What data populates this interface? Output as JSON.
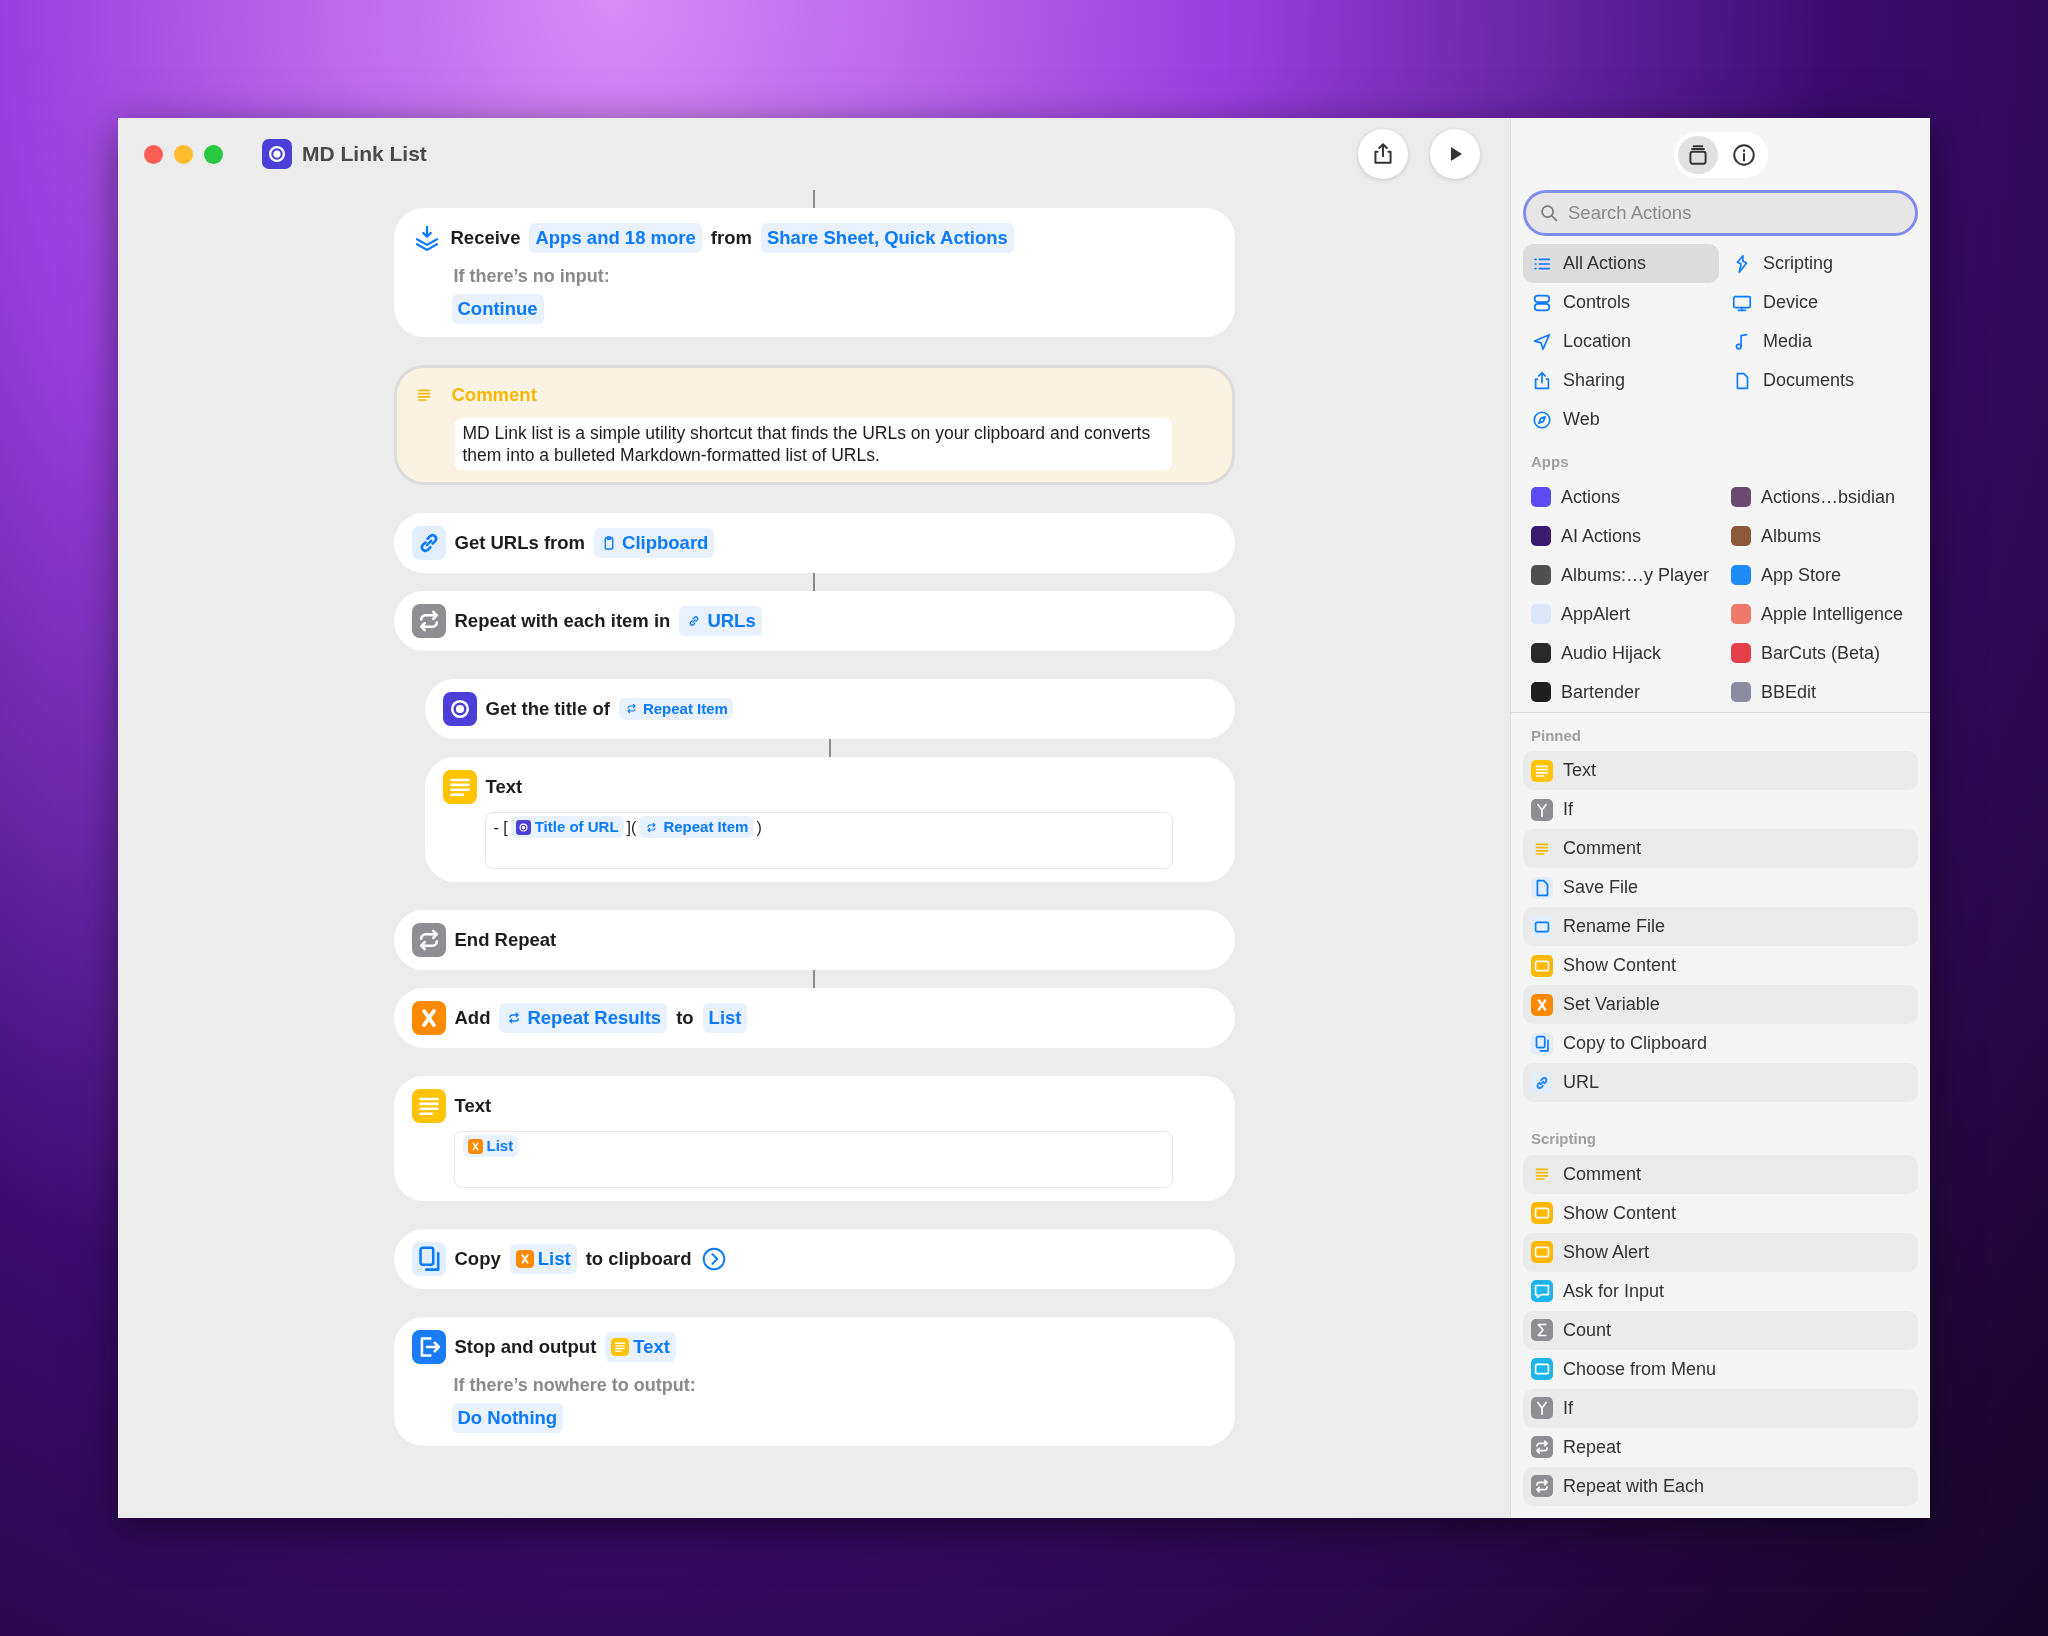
{
  "window": {
    "title": "MD Link List"
  },
  "view_switch": [
    {
      "kind": "library",
      "selected": true
    },
    {
      "kind": "info",
      "selected": false
    }
  ],
  "actions": [
    {
      "kind": "receive",
      "connected": true,
      "parts": [
        {
          "kind": "label",
          "text": "Receive"
        },
        {
          "kind": "token",
          "text": "Apps and 18 more"
        },
        {
          "kind": "label",
          "text": "from"
        },
        {
          "kind": "token",
          "text": "Share Sheet, Quick Actions"
        }
      ],
      "fallback_label": "If there’s no input:",
      "fallback": "Continue"
    },
    {
      "kind": "comment",
      "connected": false,
      "title": "Comment",
      "text": "MD Link list is a simple utility shortcut that finds the URLs on your clipboard and converts them into a bulleted Markdown-formatted list of URLs."
    },
    {
      "kind": "link",
      "connected": false,
      "parts": [
        {
          "kind": "label",
          "text": "Get URLs from"
        },
        {
          "kind": "clipboard-token",
          "text": "Clipboard"
        }
      ]
    },
    {
      "kind": "repeat",
      "connected": true,
      "parts": [
        {
          "kind": "label",
          "text": "Repeat with each item in"
        },
        {
          "kind": "link-token",
          "text": "URLs"
        }
      ],
      "children": [
        {
          "kind": "app",
          "connected": false,
          "parts": [
            {
              "kind": "label",
              "text": "Get the title of"
            },
            {
              "kind": "repeat-token",
              "text": "Repeat Item"
            }
          ]
        },
        {
          "kind": "text",
          "connected": true,
          "title": "Text",
          "content": [
            {
              "kind": "plain",
              "text": "- ["
            },
            {
              "kind": "app-token",
              "text": "Title of URL"
            },
            {
              "kind": "plain",
              "text": "]("
            },
            {
              "kind": "repeat-token",
              "text": "Repeat Item"
            },
            {
              "kind": "plain",
              "text": ")"
            }
          ]
        }
      ]
    },
    {
      "kind": "repeat",
      "connected": false,
      "parts": [
        {
          "kind": "label",
          "text": "End Repeat"
        }
      ]
    },
    {
      "kind": "variable",
      "connected": true,
      "parts": [
        {
          "kind": "label",
          "text": "Add"
        },
        {
          "kind": "repeat-token",
          "text": "Repeat Results"
        },
        {
          "kind": "label",
          "text": "to"
        },
        {
          "kind": "token",
          "text": "List"
        }
      ]
    },
    {
      "kind": "text",
      "connected": false,
      "title": "Text",
      "content": [
        {
          "kind": "variable-token",
          "text": "List"
        }
      ]
    },
    {
      "kind": "copy",
      "connected": false,
      "parts": [
        {
          "kind": "label",
          "text": "Copy"
        },
        {
          "kind": "variable-token",
          "text": "List"
        },
        {
          "kind": "label",
          "text": "to clipboard"
        },
        {
          "kind": "more"
        }
      ]
    },
    {
      "kind": "stop",
      "connected": false,
      "parts": [
        {
          "kind": "label",
          "text": "Stop and output"
        },
        {
          "kind": "text-token",
          "text": "Text"
        }
      ],
      "fallback_label": "If there’s nowhere to output:",
      "fallback": "Do Nothing"
    }
  ],
  "sidebar": {
    "search": {
      "placeholder": "Search Actions",
      "focused": true
    },
    "categories": [
      {
        "label": "All Actions",
        "kind": "list",
        "selected": true
      },
      {
        "label": "Scripting",
        "kind": "scripting",
        "selected": false
      },
      {
        "label": "Controls",
        "kind": "controls",
        "selected": false
      },
      {
        "label": "Device",
        "kind": "device",
        "selected": false
      },
      {
        "label": "Location",
        "kind": "location",
        "selected": false
      },
      {
        "label": "Media",
        "kind": "media",
        "selected": false
      },
      {
        "label": "Sharing",
        "kind": "sharing",
        "selected": false
      },
      {
        "label": "Documents",
        "kind": "documents",
        "selected": false
      },
      {
        "label": "Web",
        "kind": "web",
        "selected": false
      }
    ],
    "apps_header": "Apps",
    "apps": [
      {
        "label": "Actions",
        "color": "#5b4bf0"
      },
      {
        "label": "Actions…bsidian",
        "color": "#6a4a6e"
      },
      {
        "label": "AI Actions",
        "color": "#3a1a6e"
      },
      {
        "label": "Albums",
        "color": "#8a5a3a"
      },
      {
        "label": "Albums:…y Player",
        "color": "#505050"
      },
      {
        "label": "App Store",
        "color": "#1e8cf5"
      },
      {
        "label": "AppAlert",
        "color": "#dce8fa"
      },
      {
        "label": "Apple Intelligence",
        "color": "#f07a6a"
      },
      {
        "label": "Audio Hijack",
        "color": "#2a2a2a"
      },
      {
        "label": "BarCuts (Beta)",
        "color": "#e5404a"
      },
      {
        "label": "Bartender",
        "color": "#1e1e1e"
      },
      {
        "label": "BBEdit",
        "color": "#8a8aa0"
      }
    ],
    "sections": [
      {
        "title": "Pinned",
        "items": [
          {
            "label": "Text",
            "kind": "text"
          },
          {
            "label": "If",
            "kind": "if"
          },
          {
            "label": "Comment",
            "kind": "comment"
          },
          {
            "label": "Save File",
            "kind": "save"
          },
          {
            "label": "Rename File",
            "kind": "rename"
          },
          {
            "label": "Show Content",
            "kind": "show"
          },
          {
            "label": "Set Variable",
            "kind": "variable"
          },
          {
            "label": "Copy to Clipboard",
            "kind": "copy"
          },
          {
            "label": "URL",
            "kind": "link"
          }
        ]
      },
      {
        "title": "Scripting",
        "items": [
          {
            "label": "Comment",
            "kind": "comment"
          },
          {
            "label": "Show Content",
            "kind": "show"
          },
          {
            "label": "Show Alert",
            "kind": "alert"
          },
          {
            "label": "Ask for Input",
            "kind": "ask"
          },
          {
            "label": "Count",
            "kind": "count"
          },
          {
            "label": "Choose from Menu",
            "kind": "menu"
          },
          {
            "label": "If",
            "kind": "if"
          },
          {
            "label": "Repeat",
            "kind": "repeat"
          },
          {
            "label": "Repeat with Each",
            "kind": "repeat"
          }
        ]
      }
    ]
  }
}
